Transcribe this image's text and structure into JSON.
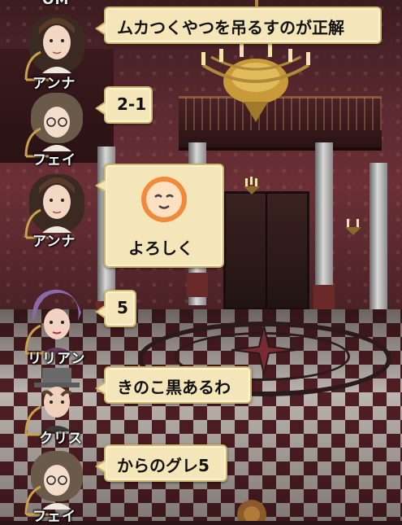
{
  "colors": {
    "bubble_fill": "#f4e6b8",
    "bubble_border": "#cfb46a",
    "name_text": "#ffffff",
    "emoji_face": "#f6b06a"
  },
  "top_partial_name": "OM",
  "messages": [
    {
      "speaker": "アンナ",
      "text": "ムカつくやつを吊るすのが正解",
      "avatar": "anna-avatar"
    },
    {
      "speaker": "フェイ",
      "text": "2-1",
      "avatar": "fei-avatar"
    },
    {
      "speaker": "アンナ",
      "text": "よろしく",
      "stamp": "smiling-face-icon",
      "avatar": "anna-avatar"
    },
    {
      "speaker": "リリアン",
      "text": "5",
      "avatar": "lillian-avatar"
    },
    {
      "speaker": "クリス",
      "text": "きのこ黒あるわ",
      "avatar": "chris-avatar"
    },
    {
      "speaker": "フェイ",
      "text": "からのグレ5",
      "avatar": "fei-avatar"
    }
  ]
}
